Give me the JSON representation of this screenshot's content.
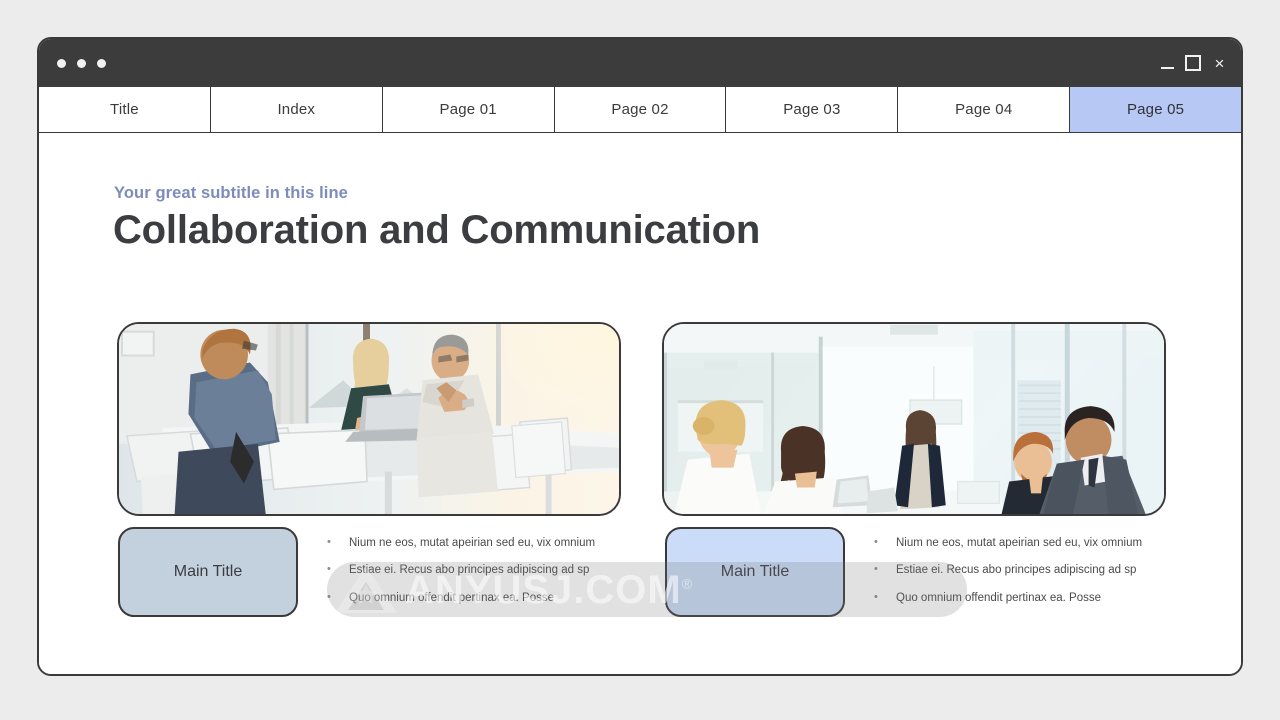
{
  "window": {
    "titlebar": {
      "dots_count": 3,
      "minimize_label": "Minimize",
      "maximize_label": "Maximize",
      "close_label": "Close",
      "close_glyph": "×",
      "background_color": "#3d3c3c"
    },
    "border_color": "#3a3a3a",
    "background_color": "#ffffff"
  },
  "tabs": {
    "active_index": 6,
    "active_color": "#b8c8f5",
    "items": [
      {
        "label": "Title"
      },
      {
        "label": "Index"
      },
      {
        "label": "Page 01"
      },
      {
        "label": "Page 02"
      },
      {
        "label": "Page 03"
      },
      {
        "label": "Page 04"
      },
      {
        "label": "Page 05"
      }
    ]
  },
  "slide": {
    "subtitle": "Your great subtitle in this line",
    "subtitle_color": "#7d8cba",
    "title": "Collaboration and Communication",
    "title_color": "#3b3d40",
    "photos": [
      {
        "name": "meeting-room-photo",
        "alt": "Three colleagues meeting around a white conference table with a laptop, bright windows behind"
      },
      {
        "name": "office-discussion-photo",
        "alt": "Five business people in a bright glass office, a woman standing and speaking to seated colleagues"
      }
    ],
    "columns": [
      {
        "box_label": "Main Title",
        "box_color": "#c3d0dd",
        "bullets": [
          "Nium ne eos, mutat apeirian sed eu, vix omnium",
          "Estiae ei. Recus abo principes adipiscing ad sp",
          "Quo omnium offendit pertinax ea. Posse"
        ]
      },
      {
        "box_label": "Main Title",
        "box_color": "#cadcf8",
        "bullets": [
          "Nium ne eos, mutat apeirian sed eu, vix omnium",
          "Estiae ei. Recus abo principes adipiscing ad sp",
          "Quo omnium offendit pertinax ea. Posse"
        ]
      }
    ],
    "bullet_marker": "•",
    "watermark": {
      "text": "ANYUSJ.COM",
      "registered_mark": "®"
    }
  }
}
